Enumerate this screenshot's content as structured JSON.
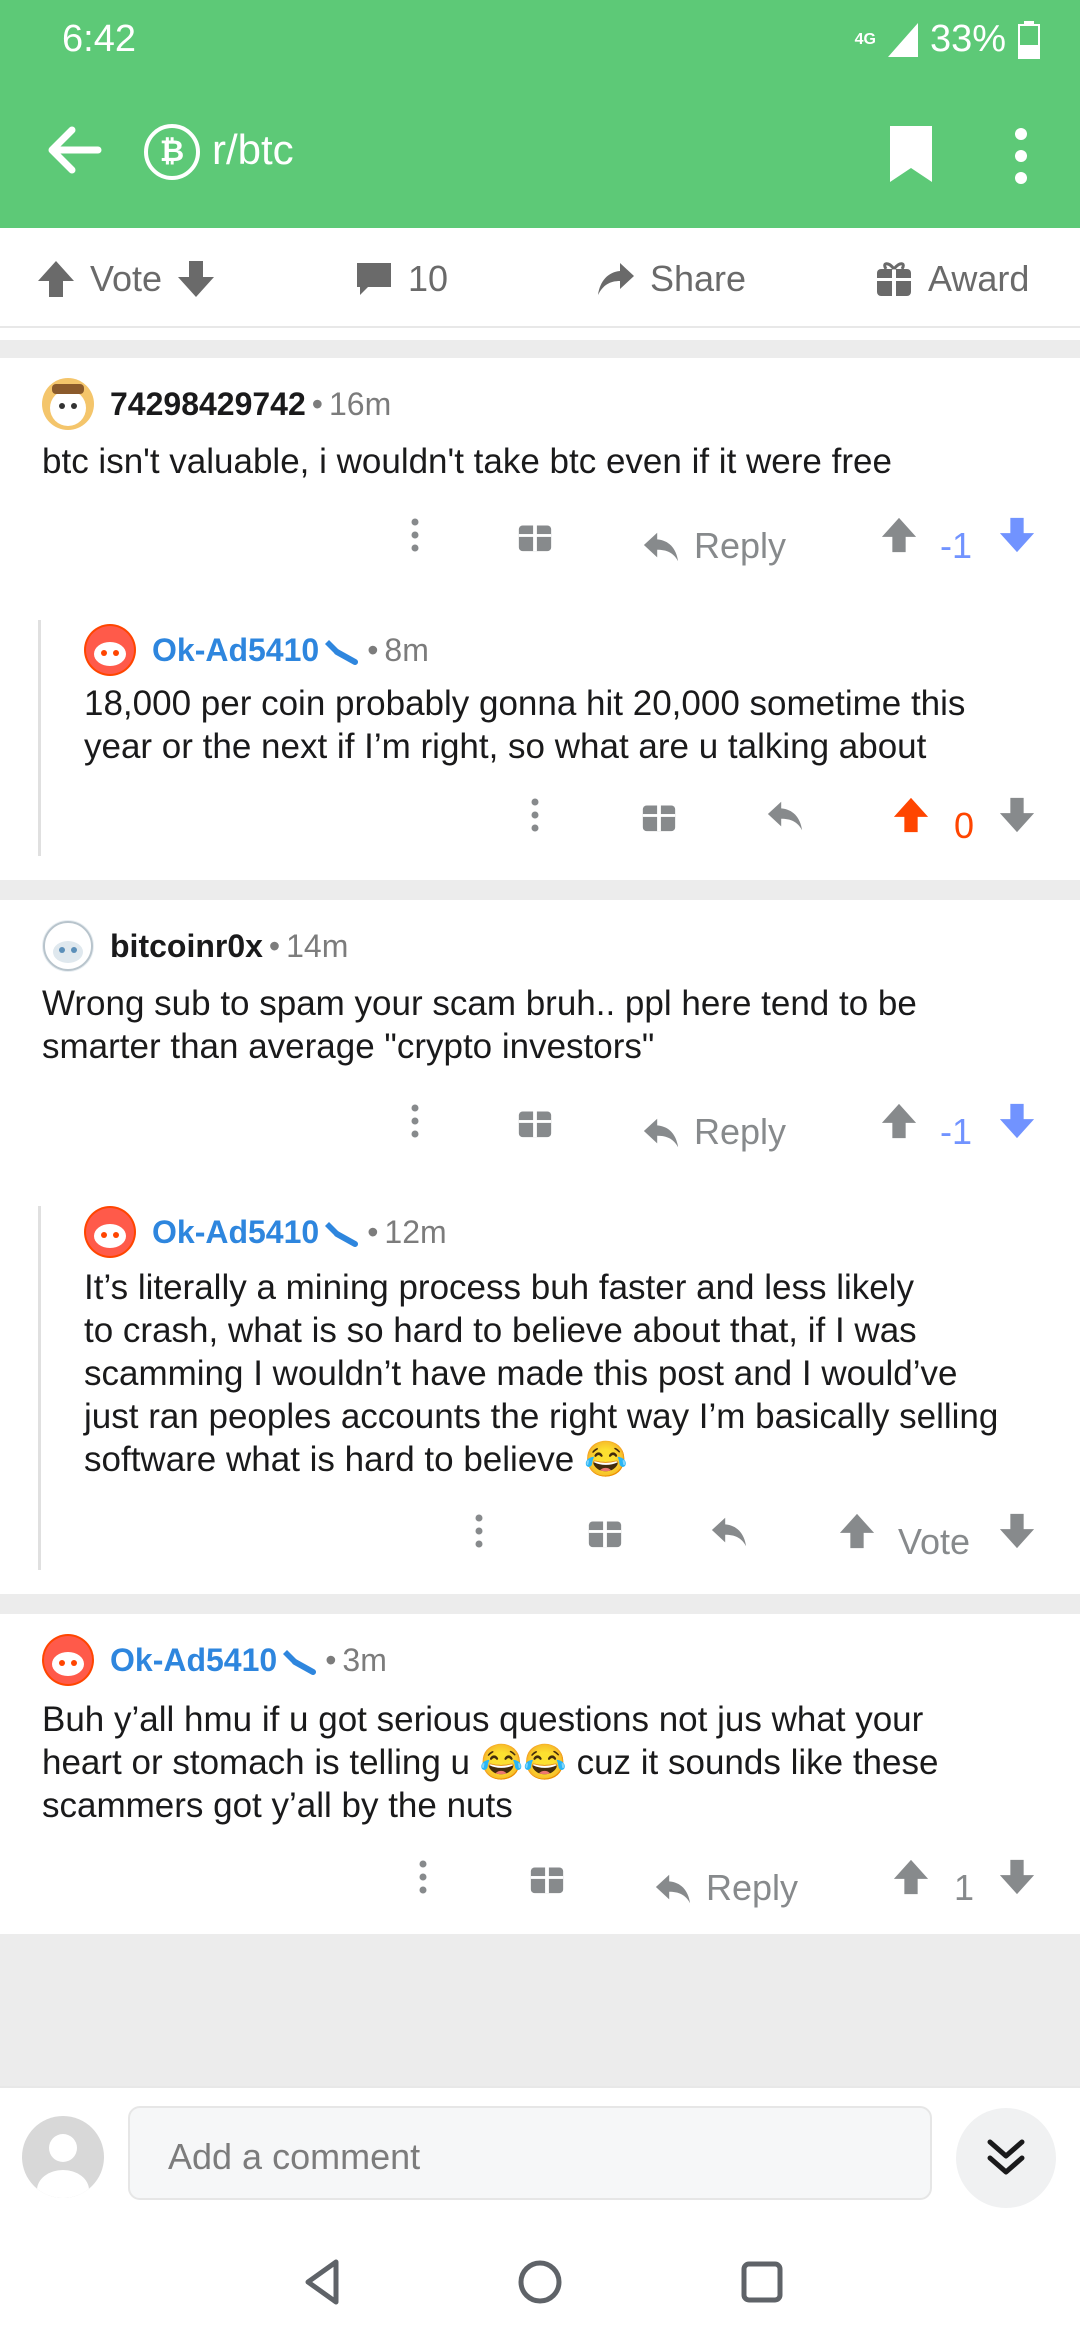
{
  "status_bar": {
    "time": "6:42",
    "network": "4G",
    "battery": "33%"
  },
  "header": {
    "subreddit": "r/btc",
    "sub_icon": "₿"
  },
  "post_actions": {
    "vote_label": "Vote",
    "comment_count": "10",
    "share_label": "Share",
    "award_label": "Award"
  },
  "comments": [
    {
      "author": "74298429742",
      "time": "16m",
      "text": "btc isn't valuable, i wouldn't take btc even if it were free",
      "reply_label": "Reply",
      "score": "-1"
    },
    {
      "author": "Ok-Ad5410",
      "time": "8m",
      "text_lines": [
        "18,000 per coin probably gonna hit 20,000 sometime this",
        "year or the next if I’m right, so what are u talking about"
      ],
      "score": "0"
    },
    {
      "author": "bitcoinr0x",
      "time": "14m",
      "text_lines": [
        "Wrong sub to spam your scam bruh.. ppl here tend to be",
        "smarter than average \"crypto investors\""
      ],
      "reply_label": "Reply",
      "score": "-1"
    },
    {
      "author": "Ok-Ad5410",
      "time": "12m",
      "text_lines": [
        "It’s literally a mining process buh faster and less likely",
        "to crash, what is so hard to believe about that, if I was",
        "scamming I wouldn’t have made this post and I would’ve",
        "just ran peoples accounts the right way I’m basically selling",
        "software what is hard to believe 😂"
      ],
      "vote_label": "Vote"
    },
    {
      "author": "Ok-Ad5410",
      "time": "3m",
      "text_lines": [
        "Buh y’all hmu if u got serious questions not jus what your",
        "heart or stomach is telling u 😂😂 cuz it sounds like these",
        "scammers got y’all by the nuts"
      ],
      "reply_label": "Reply",
      "score": "1"
    }
  ],
  "composer": {
    "placeholder": "Add a comment"
  },
  "colors": {
    "header_green": "#5dc977",
    "op_blue": "#2e86de",
    "upvote_orange": "#ff4500",
    "downvote_blue": "#7193ff"
  }
}
